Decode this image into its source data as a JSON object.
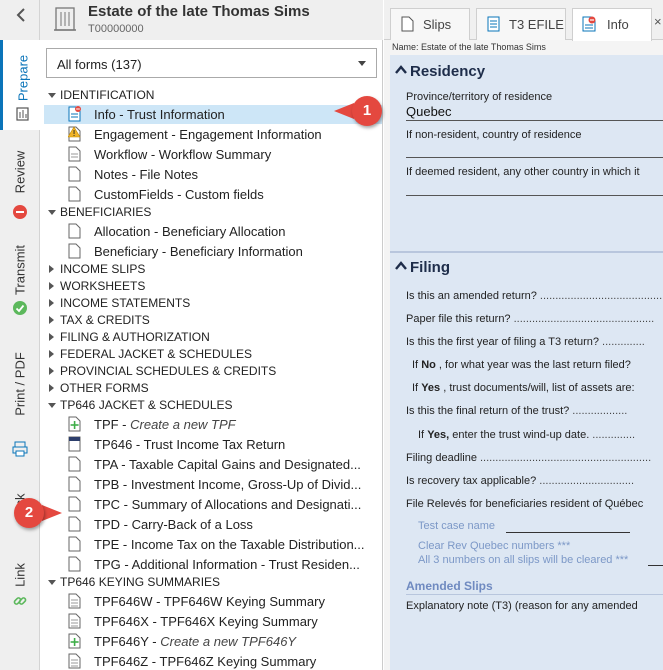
{
  "nav": {
    "tabs": {
      "prepare": "Prepare",
      "review": "Review",
      "transmit": "Transmit",
      "print_pdf": "Print / PDF",
      "check": "ck",
      "link": "Link"
    }
  },
  "client": {
    "name": "Estate of the late Thomas Sims",
    "id": "T00000000"
  },
  "forms_filter": {
    "label": "All forms (137)"
  },
  "tree": {
    "identification": {
      "group": "IDENTIFICATION",
      "items": [
        {
          "code": "Info",
          "desc": "Trust Information"
        },
        {
          "code": "Engagement",
          "desc": "Engagement Information"
        },
        {
          "code": "Workflow",
          "desc": "Workflow Summary"
        },
        {
          "code": "Notes",
          "desc": "File Notes"
        },
        {
          "code": "CustomFields",
          "desc": "Custom fields"
        }
      ]
    },
    "beneficiaries": {
      "group": "BENEFICIARIES",
      "items": [
        {
          "code": "Allocation",
          "desc": "Beneficiary Allocation"
        },
        {
          "code": "Beneficiary",
          "desc": "Beneficiary Information"
        }
      ]
    },
    "collapsed_groups": [
      "INCOME SLIPS",
      "WORKSHEETS",
      "INCOME STATEMENTS",
      "TAX & CREDITS",
      "FILING & AUTHORIZATION",
      "FEDERAL JACKET & SCHEDULES",
      "PROVINCIAL SCHEDULES & CREDITS",
      "OTHER FORMS"
    ],
    "tp646_jacket": {
      "group": "TP646 JACKET & SCHEDULES",
      "items": [
        {
          "code": "TPF",
          "desc": "Create a new TPF"
        },
        {
          "code": "TP646",
          "desc": "Trust Income Tax Return"
        },
        {
          "code": "TPA",
          "desc": "Taxable Capital Gains and Designated..."
        },
        {
          "code": "TPB",
          "desc": "Investment Income, Gross-Up of Divid..."
        },
        {
          "code": "TPC",
          "desc": "Summary of Allocations and Designati..."
        },
        {
          "code": "TPD",
          "desc": "Carry-Back of a Loss"
        },
        {
          "code": "TPE",
          "desc": "Income Tax on the Taxable Distribution..."
        },
        {
          "code": "TPG",
          "desc": "Additional Information - Trust Residen..."
        }
      ]
    },
    "tp646_keying": {
      "group": "TP646 KEYING SUMMARIES",
      "items": [
        {
          "code": "TPF646W",
          "desc": "TPF646W Keying Summary"
        },
        {
          "code": "TPF646X",
          "desc": "TPF646X Keying Summary"
        },
        {
          "code": "TPF646Y",
          "desc": "Create a new TPF646Y"
        },
        {
          "code": "TPF646Z",
          "desc": "TPF646Z Keying Summary"
        }
      ]
    }
  },
  "doc_tabs": {
    "slips": "Slips",
    "t3efile": "T3 EFILE",
    "info": "Info",
    "close": "×"
  },
  "form": {
    "name_line": "Name: Estate of the late Thomas Sims",
    "residency": {
      "title": "Residency",
      "province_label": "Province/territory of residence",
      "province_value": "Quebec",
      "nonresident_label": "If non-resident, country of residence",
      "deemed_label": "If deemed resident, any other country in which it"
    },
    "filing": {
      "title": "Filing",
      "q_amended": "Is this an amended return?",
      "q_paper": "Paper file this return?",
      "q_first_year": "Is this the first year of filing a T3 return?",
      "q_if_no_prefix": "If",
      "q_if_no_bold": "No",
      "q_if_no_rest": ", for what year was the last return filed?",
      "q_if_yes_prefix": "If",
      "q_if_yes_bold": "Yes",
      "q_if_yes_rest": ", trust documents/will, list of assets are:",
      "q_final": "Is this the final return of the trust?",
      "q_windup_prefix": "If",
      "q_windup_bold": "Yes,",
      "q_windup_rest": "enter the trust wind-up date.",
      "q_deadline": "Filing deadline",
      "q_recovery": "Is recovery tax applicable?",
      "q_releves": "File Relevés for beneficiaries resident of Québec",
      "test_case": "Test case name",
      "clear_rq_1": "Clear Rev Quebec numbers ***",
      "clear_rq_2": "All 3 numbers on all slips will be cleared ***",
      "amended_slips": "Amended Slips",
      "explanatory": "Explanatory note (T3) (reason for any amended"
    }
  },
  "callouts": {
    "one": "1",
    "two": "2"
  },
  "colors": {
    "accent": "#0a74b9",
    "selected_row": "#cde6f7",
    "form_bg": "#dde7f3",
    "callout": "#e4483f",
    "link_text": "#7c98c7"
  }
}
